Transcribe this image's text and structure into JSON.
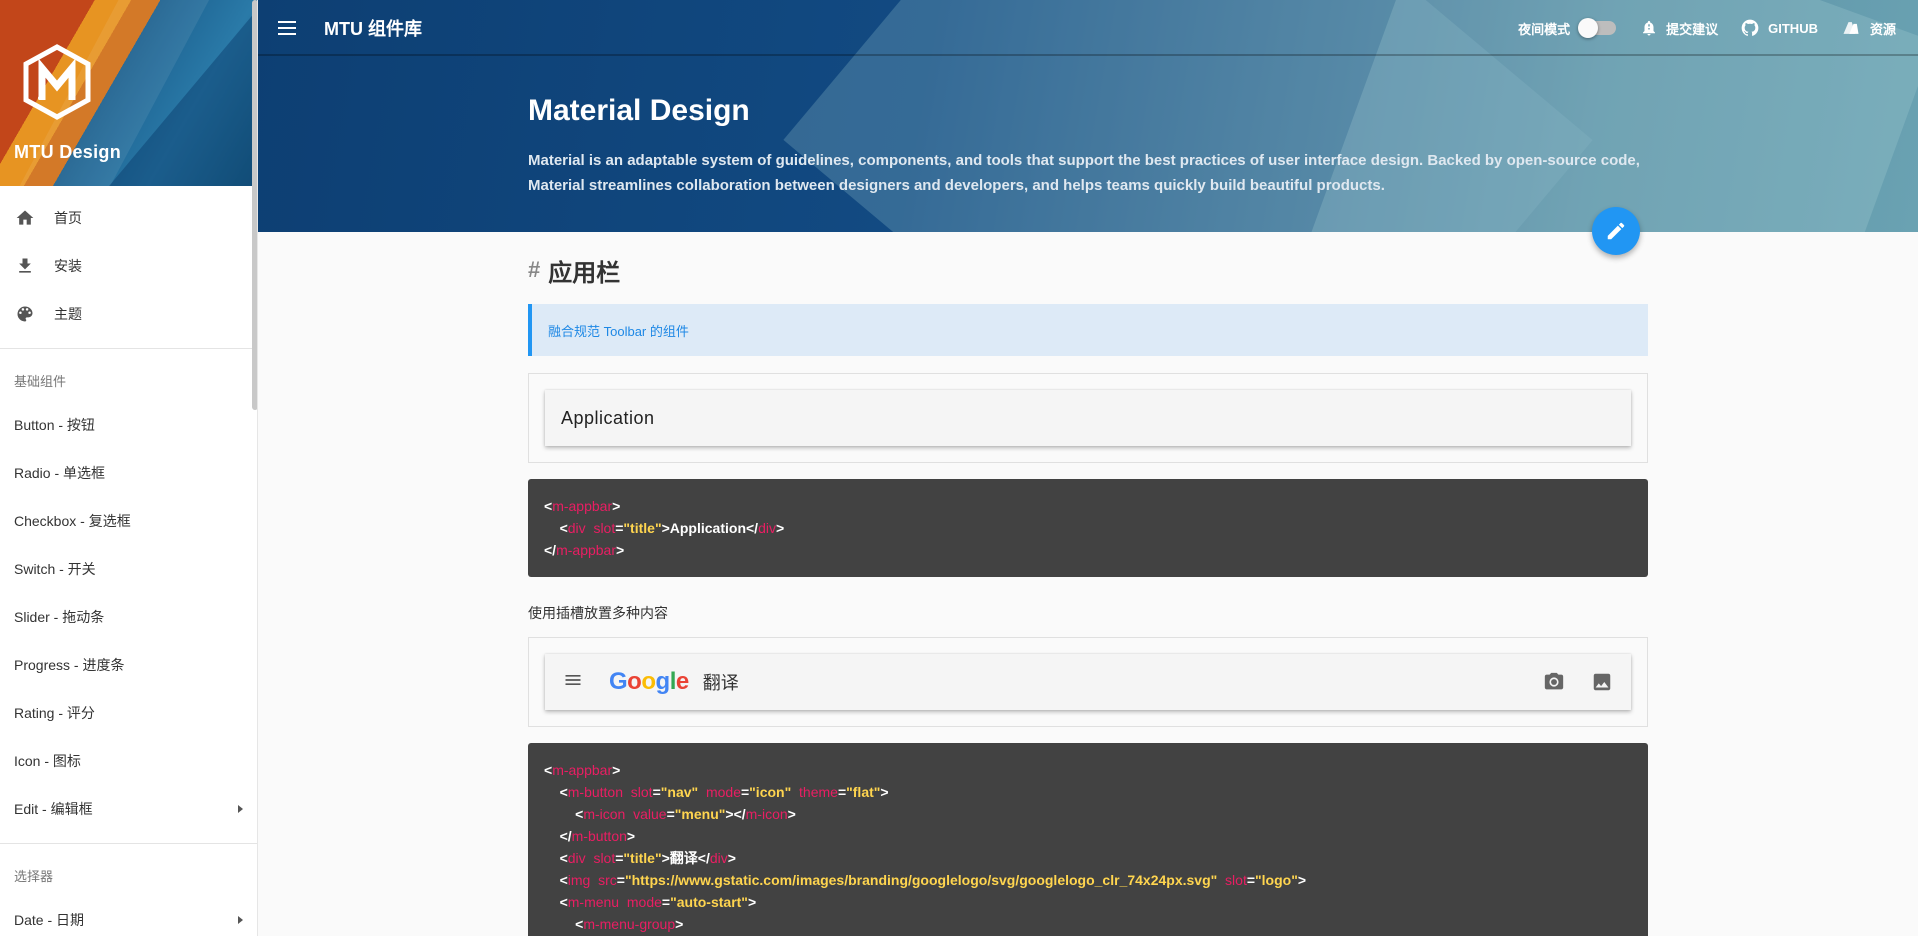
{
  "sidebar": {
    "brand": "MTU Design",
    "nav": [
      {
        "label": "首页",
        "icon": "home-icon"
      },
      {
        "label": "安装",
        "icon": "download-icon"
      },
      {
        "label": "主题",
        "icon": "palette-icon"
      }
    ],
    "group1_title": "基础组件",
    "group1_items": [
      {
        "label": "Button - 按钮"
      },
      {
        "label": "Radio - 单选框"
      },
      {
        "label": "Checkbox - 复选框"
      },
      {
        "label": "Switch - 开关"
      },
      {
        "label": "Slider - 拖动条"
      },
      {
        "label": "Progress - 进度条"
      },
      {
        "label": "Rating - 评分"
      },
      {
        "label": "Icon - 图标"
      },
      {
        "label": "Edit - 编辑框",
        "expandable": true
      }
    ],
    "group2_title": "选择器",
    "group2_items": [
      {
        "label": "Date - 日期",
        "expandable": true
      }
    ]
  },
  "topbar": {
    "title": "MTU 组件库",
    "night_mode": "夜间模式",
    "night_mode_on": false,
    "feedback": "提交建议",
    "github": "GITHUB",
    "resources": "资源"
  },
  "hero": {
    "title": "Material Design",
    "description": "Material is an adaptable system of guidelines, components, and tools that support the best practices of user interface design. Backed by open-source code, Material streamlines collaboration between designers and developers, and helps teams quickly build beautiful products."
  },
  "section": {
    "hash": "#",
    "title": "应用栏",
    "tip": "融合规范 Toolbar 的组件",
    "demo1_title": "Application",
    "paragraph": "使用插槽放置多种内容",
    "demo2_logo": "Google",
    "demo2_title": "翻译"
  },
  "colors": {
    "accent": "#2196f3",
    "code_bg": "#424242",
    "code_tag": "#e91e63",
    "code_string": "#ffd54f"
  }
}
